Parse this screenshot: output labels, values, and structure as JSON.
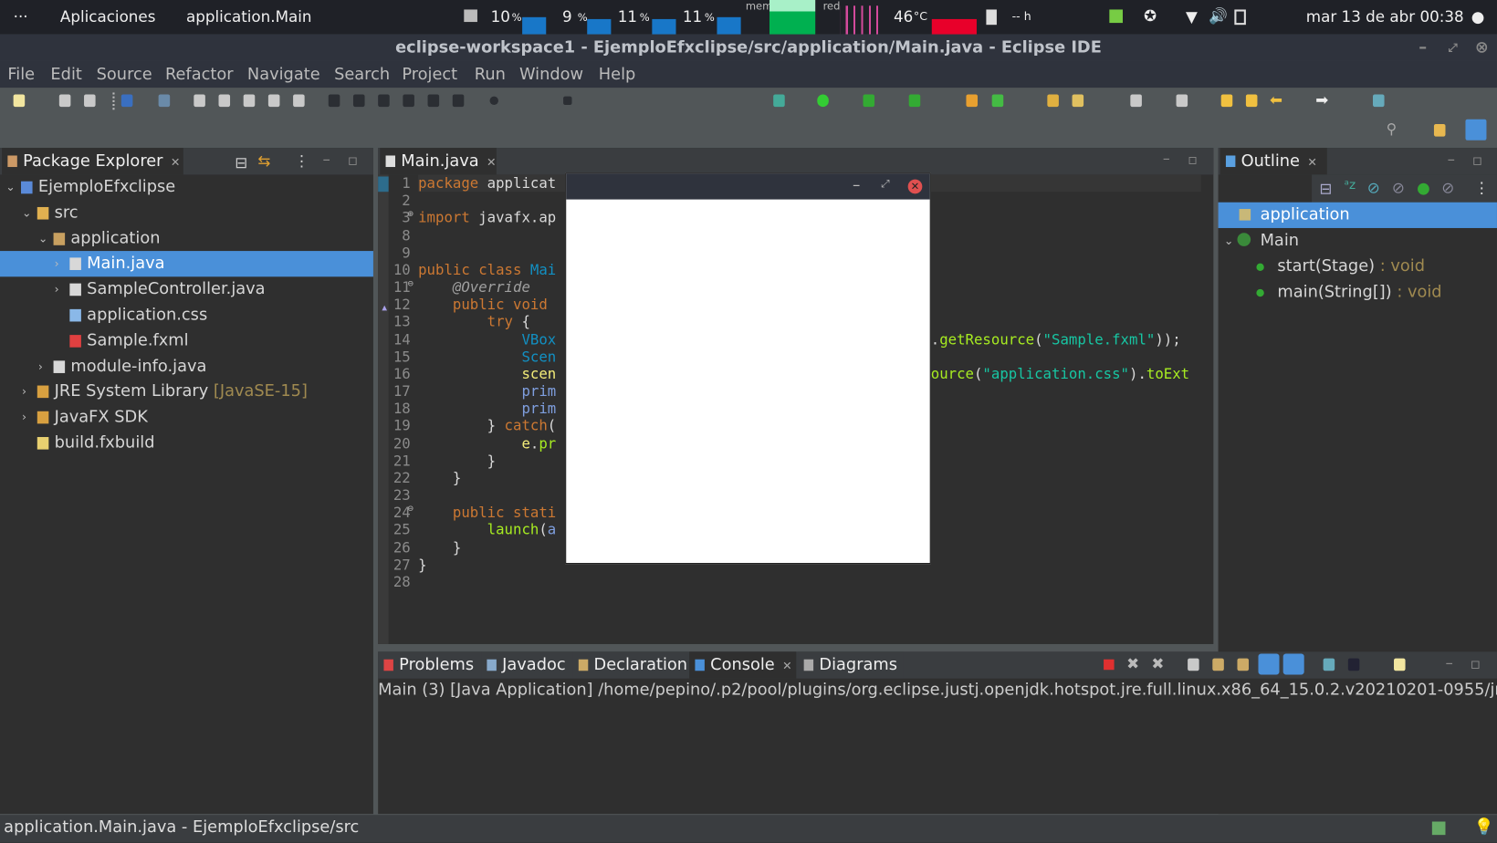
{
  "system_bar": {
    "activities": "···",
    "apps": "Aplicaciones",
    "app_name": "application.Main",
    "cpu": [
      "10",
      "9",
      "11",
      "11"
    ],
    "percent": "%",
    "mem_label": "mem",
    "net_label": "red",
    "temp": "46",
    "temp_unit": "°C",
    "battery_text": "-- h",
    "datetime": "mar 13 de abr  00:38",
    "mem_color": "#00b050",
    "temp_color": "#e8002a"
  },
  "window": {
    "title": "eclipse-workspace1 - EjemploEfxclipse/src/application/Main.java - Eclipse IDE"
  },
  "menu": [
    "File",
    "Edit",
    "Source",
    "Refactor",
    "Navigate",
    "Search",
    "Project",
    "Run",
    "Window",
    "Help"
  ],
  "package_explorer": {
    "title": "Package Explorer",
    "items": [
      {
        "label": "EjemploEfxclipse",
        "level": 0,
        "expanded": true,
        "icon": "project-icon"
      },
      {
        "label": "src",
        "level": 1,
        "expanded": true,
        "icon": "folder-icon"
      },
      {
        "label": "application",
        "level": 2,
        "expanded": true,
        "icon": "package-icon"
      },
      {
        "label": "Main.java",
        "level": 3,
        "collapsed": true,
        "selected": true,
        "icon": "java-file-icon"
      },
      {
        "label": "SampleController.java",
        "level": 3,
        "collapsed": true,
        "icon": "java-file-icon"
      },
      {
        "label": "application.css",
        "level": 3,
        "icon": "css-file-icon"
      },
      {
        "label": "Sample.fxml",
        "level": 3,
        "icon": "fxml-file-icon"
      },
      {
        "label": "module-info.java",
        "level": 2,
        "collapsed": true,
        "icon": "java-file-icon"
      },
      {
        "label": "JRE System Library",
        "suffix": "[JavaSE-15]",
        "level": 1,
        "collapsed": true,
        "icon": "library-icon"
      },
      {
        "label": "JavaFX SDK",
        "level": 1,
        "collapsed": true,
        "icon": "library-icon"
      },
      {
        "label": "build.fxbuild",
        "level": 1,
        "icon": "build-file-icon"
      }
    ]
  },
  "editor": {
    "tab": "Main.java",
    "lines": [
      {
        "n": "1",
        "left": [
          [
            "kw",
            "package "
          ],
          [
            "",
            "applicat"
          ]
        ]
      },
      {
        "n": "2",
        "left": []
      },
      {
        "n": "3",
        "fold": "+",
        "left": [
          [
            "kw",
            "import "
          ],
          [
            "",
            "javafx.ap"
          ]
        ]
      },
      {
        "n": "8",
        "left": []
      },
      {
        "n": "9",
        "left": []
      },
      {
        "n": "10",
        "left": [
          [
            "kw",
            "public class "
          ],
          [
            "ty",
            "Mai"
          ]
        ]
      },
      {
        "n": "11",
        "fold": "-",
        "left": [
          [
            "an",
            "    @Override"
          ]
        ]
      },
      {
        "n": "12",
        "left": [
          [
            "kw",
            "    public void"
          ]
        ]
      },
      {
        "n": "13",
        "left": [
          [
            "kw",
            "        try "
          ],
          [
            "",
            "{"
          ]
        ]
      },
      {
        "n": "14",
        "left": [
          [
            "ty",
            "            VBox"
          ]
        ],
        "right": [
          [
            "",
            "."
          ],
          [
            "fn",
            "getResource"
          ],
          [
            "",
            "("
          ],
          [
            "st",
            "\"Sample.fxml\""
          ],
          [
            "",
            "));"
          ]
        ]
      },
      {
        "n": "15",
        "left": [
          [
            "ty",
            "            Scen"
          ]
        ]
      },
      {
        "n": "16",
        "left": [
          [
            "lc",
            "            scen"
          ]
        ],
        "right": [
          [
            "fn",
            "ource"
          ],
          [
            "",
            "("
          ],
          [
            "st",
            "\"application.css\""
          ],
          [
            "",
            ")."
          ],
          [
            "fn",
            "toExt"
          ]
        ]
      },
      {
        "n": "17",
        "left": [
          [
            "vr",
            "            prim"
          ]
        ]
      },
      {
        "n": "18",
        "left": [
          [
            "vr",
            "            prim"
          ]
        ]
      },
      {
        "n": "19",
        "left": [
          [
            "",
            "        } "
          ],
          [
            "kw",
            "catch"
          ],
          [
            "",
            "("
          ]
        ]
      },
      {
        "n": "20",
        "left": [
          [
            "lc",
            "            e"
          ],
          [
            "",
            "."
          ],
          [
            "fn",
            "pr"
          ]
        ]
      },
      {
        "n": "21",
        "left": [
          [
            "",
            "        }"
          ]
        ]
      },
      {
        "n": "22",
        "left": [
          [
            "",
            "    }"
          ]
        ]
      },
      {
        "n": "23",
        "left": []
      },
      {
        "n": "24",
        "fold": "-",
        "left": [
          [
            "kw",
            "    public stati"
          ]
        ]
      },
      {
        "n": "25",
        "left": [
          [
            "fn",
            "        launch"
          ],
          [
            "",
            "("
          ],
          [
            "vr",
            "a"
          ]
        ]
      },
      {
        "n": "26",
        "left": [
          [
            "",
            "    }"
          ]
        ]
      },
      {
        "n": "27",
        "left": [
          [
            "",
            "}"
          ]
        ]
      },
      {
        "n": "28",
        "left": []
      }
    ]
  },
  "outline": {
    "title": "Outline",
    "items": [
      {
        "label": "application",
        "selected": true
      },
      {
        "label": "Main"
      },
      {
        "label": "start(Stage)",
        "type": " : void"
      },
      {
        "label": "main(String[])",
        "type": " : void"
      }
    ]
  },
  "bottom": {
    "tabs": [
      "Problems",
      "Javadoc",
      "Declaration",
      "Console",
      "Diagrams"
    ],
    "active": "Console",
    "console_header": "Main (3) [Java Application] /home/pepino/.p2/pool/plugins/org.eclipse.justj.openjdk.hotspot.jre.full.linux.x86_64_15.0.2.v20210201-0955/jre/"
  },
  "status_bar": {
    "text": "application.Main.java - EjemploEfxclipse/src"
  }
}
